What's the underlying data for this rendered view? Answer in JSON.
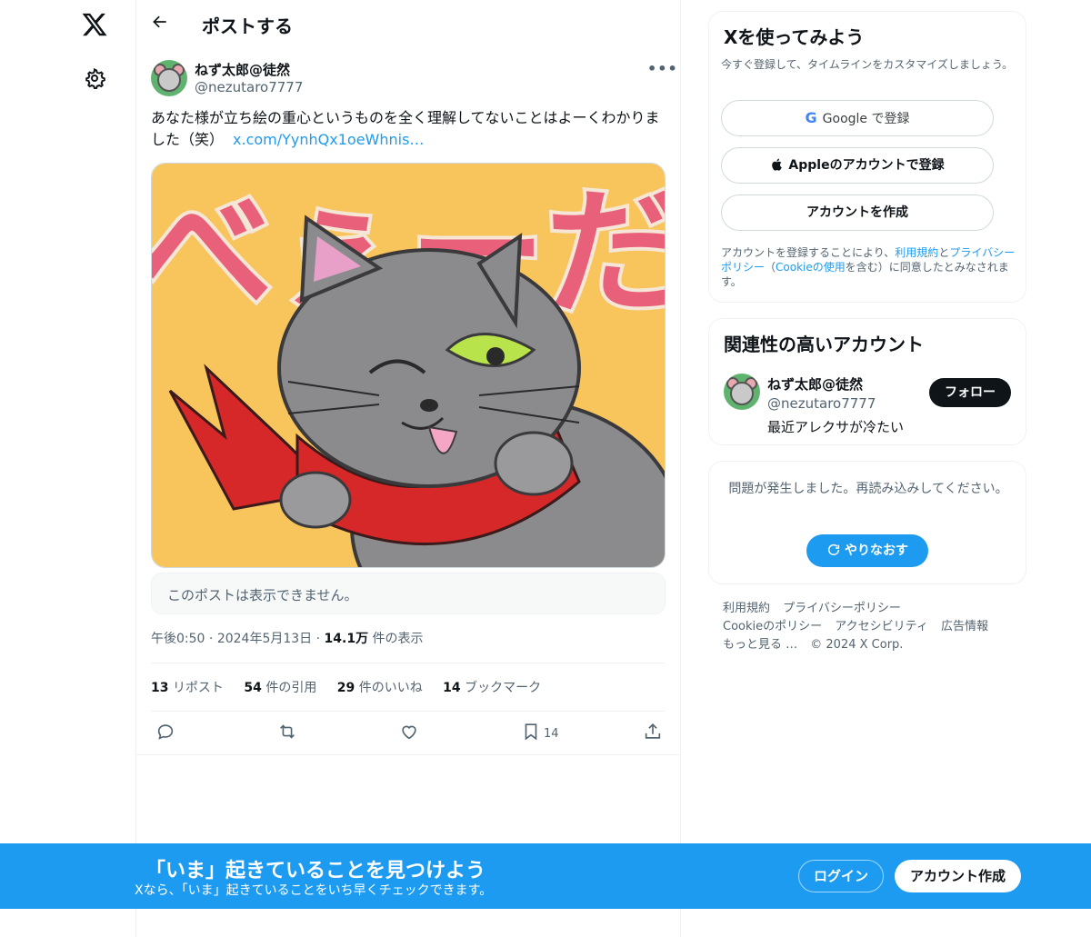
{
  "colors": {
    "accent": "#1d9bf0",
    "text": "#0f1419",
    "muted": "#536471"
  },
  "header": {
    "title": "ポストする"
  },
  "post": {
    "author_name": "ねず太郎@徒然",
    "author_handle": "@nezutaro7777",
    "text": "あなた様が立ち絵の重心というものを全く理解してないことはよーくわかりました（笑）",
    "link": "x.com/YynhQx1oeWhnis…",
    "image_text": "べぇーだ",
    "quote_unavailable": "このポストは表示できません。",
    "time": "午後0:50",
    "date": "2024年5月13日",
    "views_count": "14.1万",
    "views_label": "件の表示",
    "stats": {
      "reposts_count": "13",
      "reposts_label": "リポスト",
      "quotes_count": "54",
      "quotes_label": "件の引用",
      "likes_count": "29",
      "likes_label": "件のいいね",
      "bookmarks_count": "14",
      "bookmarks_label": "ブックマーク"
    },
    "bookmark_action_count": "14"
  },
  "signup_card": {
    "title": "Xを使ってみよう",
    "subtitle": "今すぐ登録して、タイムラインをカスタマイズしましょう。",
    "google_label": "Google で登録",
    "apple_label": "Appleのアカウントで登録",
    "create_label": "アカウントを作成",
    "legal_pre": "アカウントを登録することにより、",
    "terms": "利用規約",
    "and": "と",
    "privacy": "プライバシーポリシー",
    "paren_open": "（",
    "cookie_use": "Cookieの使用",
    "legal_post": "を含む）に同意したとみなされます。"
  },
  "relevant": {
    "title": "関連性の高いアカウント",
    "name": "ねず太郎@徒然",
    "handle": "@nezutaro7777",
    "bio": "最近アレクサが冷たい",
    "follow_label": "フォロー"
  },
  "error_card": {
    "message": "問題が発生しました。再読み込みしてください。",
    "retry_label": "やりなおす"
  },
  "footer": {
    "links": [
      "利用規約",
      "プライバシーポリシー",
      "Cookieのポリシー",
      "アクセシビリティ",
      "広告情報",
      "もっと見る …",
      "© 2024 X Corp."
    ]
  },
  "banner": {
    "title": "「いま」起きていることを見つけよう",
    "subtitle": "Xなら、「いま」起きていることをいち早くチェックできます。",
    "login_label": "ログイン",
    "signup_label": "アカウント作成"
  }
}
